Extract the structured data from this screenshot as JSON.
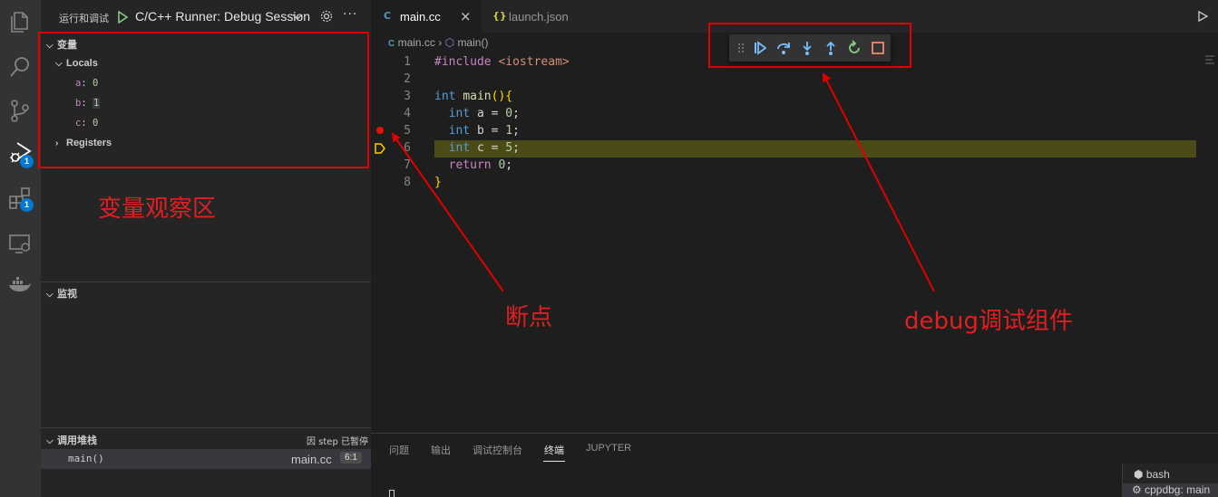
{
  "activity_bar": {
    "icons": [
      "files-icon",
      "search-icon",
      "source-control-icon",
      "run-debug-icon",
      "extensions-icon",
      "remote-explorer-icon",
      "docker-icon"
    ],
    "debug_badge": "1",
    "extensions_badge": "1"
  },
  "sidebar": {
    "title": "运行和调试",
    "config": "C/C++ Runner: Debug Session",
    "variables": {
      "title": "变量",
      "locals_label": "Locals",
      "locals": [
        {
          "name": "a",
          "value": "0"
        },
        {
          "name": "b",
          "value": "1"
        },
        {
          "name": "c",
          "value": "0"
        }
      ],
      "registers_label": "Registers"
    },
    "watch": {
      "title": "监视"
    },
    "call_stack": {
      "title": "调用堆栈",
      "status": "因 step 已暂停",
      "frame_fn": "main()",
      "frame_file": "main.cc",
      "frame_pos": "6:1"
    }
  },
  "tabs": [
    {
      "label": "main.cc",
      "active": true
    },
    {
      "label": "launch.json",
      "active": false
    }
  ],
  "breadcrumbs": {
    "file": "main.cc",
    "symbol": "main()"
  },
  "code": {
    "current_line": 6,
    "breakpoint_line": 5,
    "lines": [
      {
        "n": "1"
      },
      {
        "n": "2"
      },
      {
        "n": "3"
      },
      {
        "n": "4"
      },
      {
        "n": "5"
      },
      {
        "n": "6"
      },
      {
        "n": "7"
      },
      {
        "n": "8"
      }
    ],
    "tokens": {
      "l1_a": "#include ",
      "l1_b": "<iostream>",
      "l3_kw": "int",
      "l3_fn": "main",
      "l3_p": "()",
      "l3_b": "{",
      "l4_kw": "int",
      "l4_rest": " a = ",
      "l4_num": "0",
      "l4_end": ";",
      "l5_kw": "int",
      "l5_rest": " b = ",
      "l5_num": "1",
      "l5_end": ";",
      "l6_kw": "int",
      "l6_rest": " c = ",
      "l6_num": "5",
      "l6_end": ";",
      "l7_kw": "return",
      "l7_rest": " ",
      "l7_num": "0",
      "l7_end": ";",
      "l8_b": "}"
    }
  },
  "panel": {
    "tabs": [
      "问题",
      "输出",
      "调试控制台",
      "终端",
      "JUPYTER"
    ],
    "active_tab": "终端",
    "terminals": [
      "bash",
      "cppdbg: main"
    ]
  },
  "annotations": {
    "variables_label": "变量观察区",
    "breakpoint_label": "断点",
    "toolbar_label": "debug调试组件",
    "color": "#e00000"
  }
}
